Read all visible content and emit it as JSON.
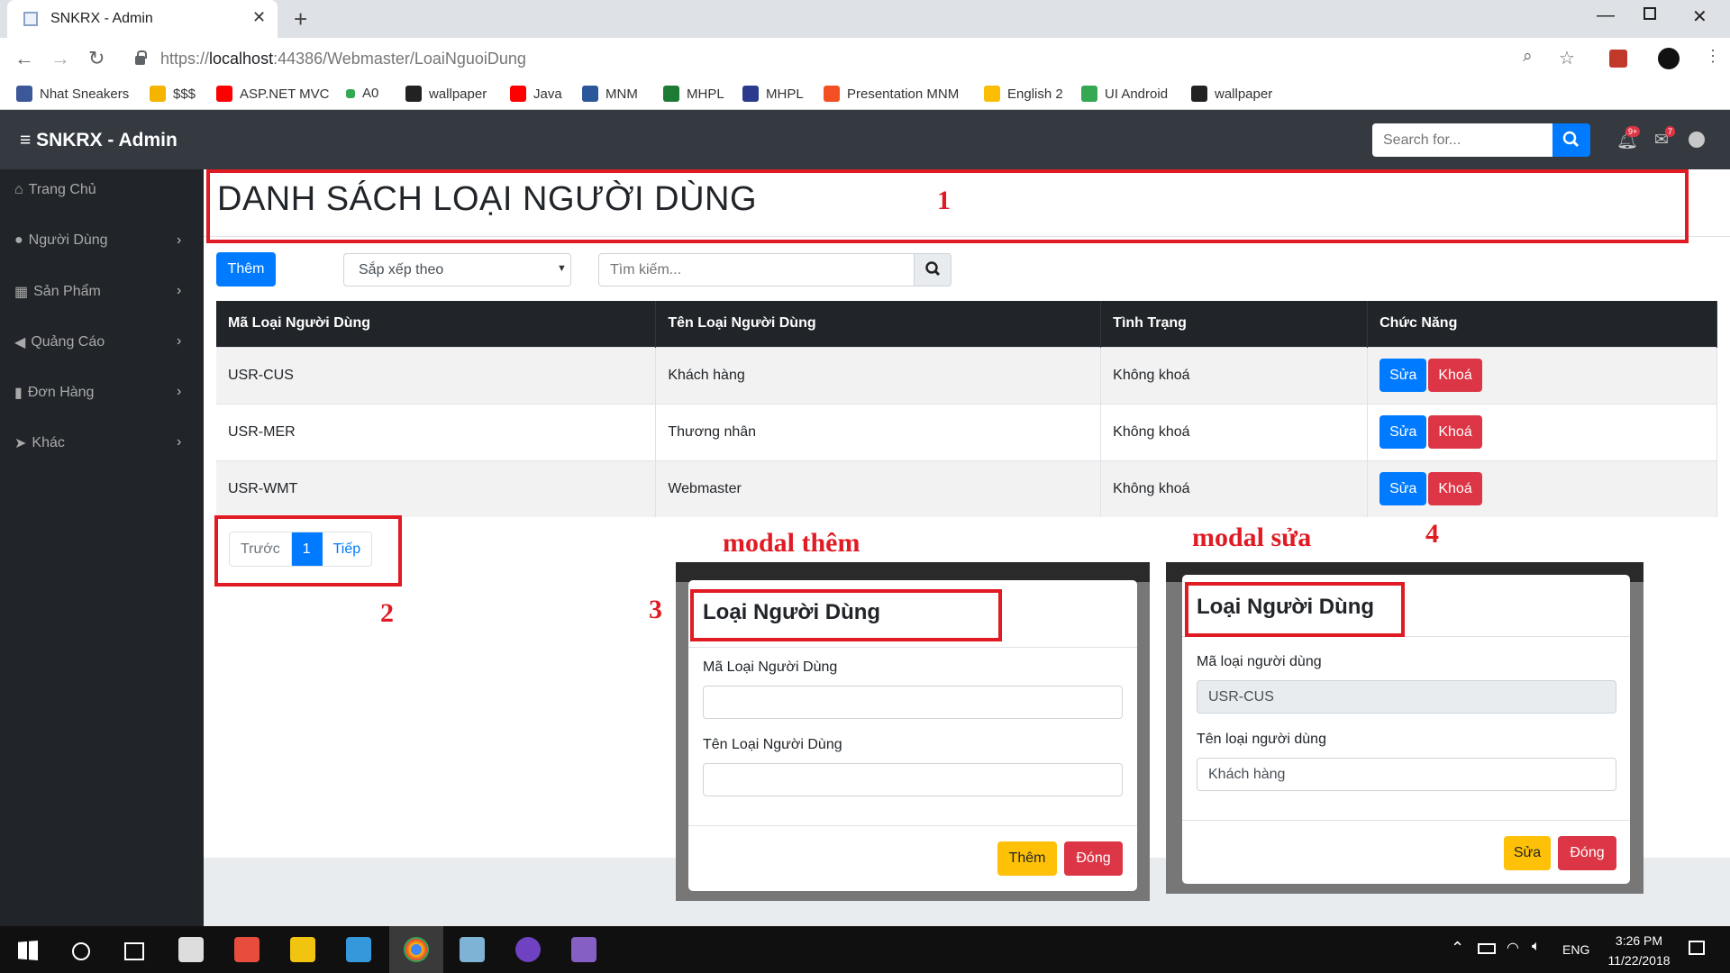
{
  "browser": {
    "tab_title": "SNKRX - Admin",
    "tab_close": "✕",
    "new_tab": "+",
    "url_prefix": "https://",
    "url_host": "localhost",
    "url_rest": ":44386/Webmaster/LoaiNguoiDung",
    "bookmarks": [
      {
        "label": "Nhat Sneakers",
        "color": "#3b5998"
      },
      {
        "label": "$$$",
        "color": "#f4b400"
      },
      {
        "label": "ASP.NET MVC",
        "color": "#ff0000"
      },
      {
        "label": "A0",
        "color": "#34a853"
      },
      {
        "label": "wallpaper",
        "color": "#222222"
      },
      {
        "label": "Java",
        "color": "#ff0000"
      },
      {
        "label": "MNM",
        "color": "#2b579a"
      },
      {
        "label": "MHPL",
        "color": "#1e7b34"
      },
      {
        "label": "MHPL",
        "color": "#2b3a8c"
      },
      {
        "label": "Presentation MNM",
        "color": "#f25022"
      },
      {
        "label": "English 2",
        "color": "#fbbc04"
      },
      {
        "label": "UI Android",
        "color": "#34a853"
      },
      {
        "label": "wallpaper",
        "color": "#222222"
      }
    ]
  },
  "navbar": {
    "brand": "≡ SNKRX - Admin",
    "search_placeholder": "Search for...",
    "bell_badge": "9+",
    "mail_badge": "7"
  },
  "sidebar": {
    "items": [
      {
        "label": "Trang Chủ",
        "icon": "home-icon",
        "glyph": "⌂"
      },
      {
        "label": "Người Dùng",
        "icon": "user-icon",
        "glyph": "●"
      },
      {
        "label": "Sản Phẩm",
        "icon": "cubes-icon",
        "glyph": "▦"
      },
      {
        "label": "Quảng Cáo",
        "icon": "bullhorn-icon",
        "glyph": "◀"
      },
      {
        "label": "Đơn Hàng",
        "icon": "clipboard-icon",
        "glyph": "▮"
      },
      {
        "label": "Khác",
        "icon": "paper-plane-icon",
        "glyph": "➤"
      }
    ]
  },
  "main": {
    "title": "DANH SÁCH LOẠI NGƯỜI DÙNG",
    "add_button": "Thêm",
    "sort_placeholder": "Sắp xếp theo",
    "search_placeholder": "Tìm kiếm...",
    "table": {
      "headers": [
        "Mã Loại Người Dùng",
        "Tên Loại Người Dùng",
        "Tình Trạng",
        "Chức Năng"
      ],
      "rows": [
        {
          "code": "USR-CUS",
          "name": "Khách hàng",
          "status": "Không khoá",
          "edit": "Sửa",
          "lock": "Khoá"
        },
        {
          "code": "USR-MER",
          "name": "Thương nhân",
          "status": "Không khoá",
          "edit": "Sửa",
          "lock": "Khoá"
        },
        {
          "code": "USR-WMT",
          "name": "Webmaster",
          "status": "Không khoá",
          "edit": "Sửa",
          "lock": "Khoá"
        }
      ]
    },
    "pagination": {
      "prev": "Trước",
      "current": "1",
      "next": "Tiếp"
    }
  },
  "annotations": {
    "n1": "1",
    "n2": "2",
    "n3": "3",
    "n4": "4",
    "modal_add_caption": "modal thêm",
    "modal_edit_caption": "modal sửa",
    "color": "#e01b24"
  },
  "modal_add": {
    "title": "Loại Người Dùng",
    "label_code": "Mã Loại Người Dùng",
    "label_name": "Tên Loại Người Dùng",
    "code_value": "",
    "name_value": "",
    "submit": "Thêm",
    "close": "Đóng"
  },
  "modal_edit": {
    "title": "Loại Người Dùng",
    "label_code": "Mã loại người dùng",
    "label_name": "Tên loại người dùng",
    "code_value": "USR-CUS",
    "name_value": "Khách hàng",
    "submit": "Sửa",
    "close": "Đóng"
  },
  "taskbar": {
    "language": "ENG",
    "time": "3:26 PM",
    "date": "11/22/2018"
  }
}
